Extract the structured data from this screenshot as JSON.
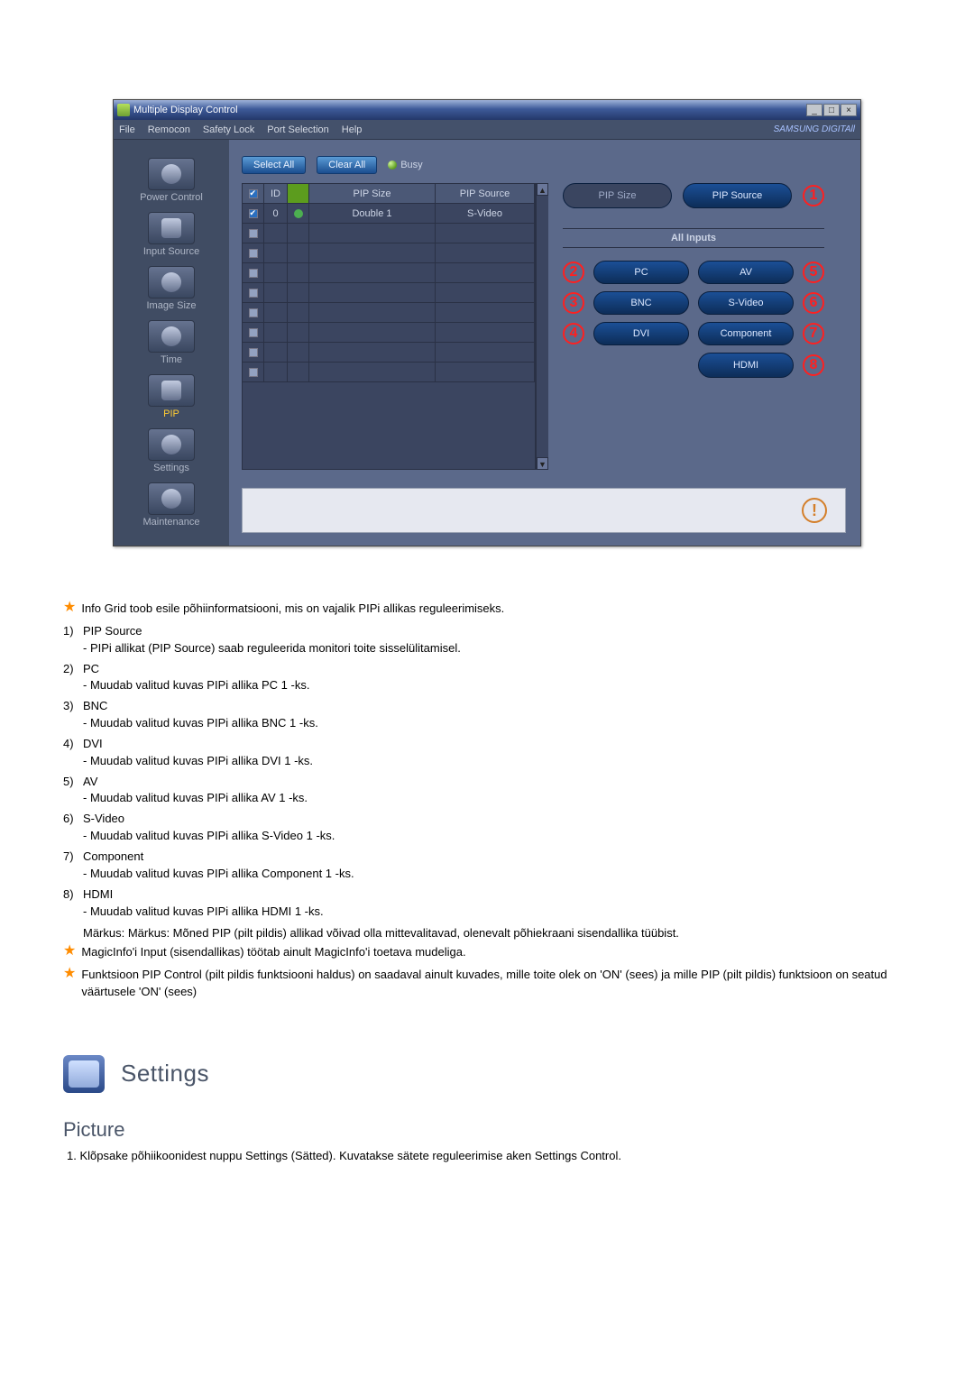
{
  "window": {
    "title": "Multiple Display Control",
    "brand": "SAMSUNG DIGITAll"
  },
  "menu": {
    "items": [
      "File",
      "Remocon",
      "Safety Lock",
      "Port Selection",
      "Help"
    ]
  },
  "sidebar": {
    "items": [
      {
        "label": "Power Control"
      },
      {
        "label": "Input Source"
      },
      {
        "label": "Image Size"
      },
      {
        "label": "Time"
      },
      {
        "label": "PIP"
      },
      {
        "label": "Settings"
      },
      {
        "label": "Maintenance"
      }
    ]
  },
  "toolbar": {
    "selectAll": "Select All",
    "clearAll": "Clear All",
    "busy": "Busy"
  },
  "grid": {
    "columns": {
      "chk": "",
      "id": "ID",
      "status": "",
      "pipSize": "PIP Size",
      "pipSource": "PIP Source"
    },
    "rows": [
      {
        "checked": true,
        "id": "0",
        "statusOk": true,
        "pipSize": "Double 1",
        "pipSource": "S-Video"
      },
      {
        "checked": false
      },
      {
        "checked": false
      },
      {
        "checked": false
      },
      {
        "checked": false
      },
      {
        "checked": false
      },
      {
        "checked": false
      },
      {
        "checked": false
      },
      {
        "checked": false
      }
    ]
  },
  "rightPanel": {
    "topLeft": "PIP Size",
    "topRight": "PIP Source",
    "subhead": "All Inputs",
    "buttons": {
      "pc": "PC",
      "av": "AV",
      "bnc": "BNC",
      "svideo": "S-Video",
      "dvi": "DVI",
      "component": "Component",
      "hdmi": "HDMI"
    },
    "callouts": {
      "topRight": "1",
      "pc": "2",
      "bnc": "3",
      "dvi": "4",
      "av": "5",
      "svideo": "6",
      "component": "7",
      "hdmi": "8"
    }
  },
  "doc": {
    "introStar": "Info Grid toob esile põhiinformatsiooni, mis on vajalik PIPi allikas reguleerimiseks.",
    "list": [
      {
        "num": "1)",
        "title": "PIP Source",
        "desc": "- PIPi allikat (PIP Source) saab reguleerida monitori toite sisselülitamisel."
      },
      {
        "num": "2)",
        "title": "PC",
        "desc": "- Muudab valitud kuvas PIPi allika PC 1 -ks."
      },
      {
        "num": "3)",
        "title": "BNC",
        "desc": "- Muudab valitud kuvas PIPi allika BNC 1 -ks."
      },
      {
        "num": "4)",
        "title": "DVI",
        "desc": "- Muudab valitud kuvas PIPi allika DVI 1 -ks."
      },
      {
        "num": "5)",
        "title": "AV",
        "desc": "- Muudab valitud kuvas PIPi allika AV 1 -ks."
      },
      {
        "num": "6)",
        "title": "S-Video",
        "desc": "- Muudab valitud kuvas PIPi allika S-Video 1 -ks."
      },
      {
        "num": "7)",
        "title": "Component",
        "desc": "- Muudab valitud kuvas PIPi allika Component 1 -ks."
      },
      {
        "num": "8)",
        "title": "HDMI",
        "desc": "- Muudab valitud kuvas PIPi allika HDMI 1 -ks."
      }
    ],
    "note": "Märkus: Märkus: Mõned PIP (pilt pildis) allikad võivad olla mittevalitavad, olenevalt põhiekraani sisendallika tüübist.",
    "star2": "MagicInfo'i Input (sisendallikas) töötab ainult MagicInfo'i toetava mudeliga.",
    "star3": "Funktsioon PIP Control (pilt pildis funktsiooni haldus) on saadaval ainult kuvades, mille toite olek on 'ON' (sees) ja mille PIP (pilt pildis) funktsioon on seatud väärtusele 'ON' (sees)"
  },
  "settings": {
    "heading": "Settings"
  },
  "picture": {
    "heading": "Picture",
    "step": "1.  Klõpsake põhiikoonidest nuppu Settings (Sätted). Kuvatakse sätete reguleerimise aken Settings Control."
  }
}
